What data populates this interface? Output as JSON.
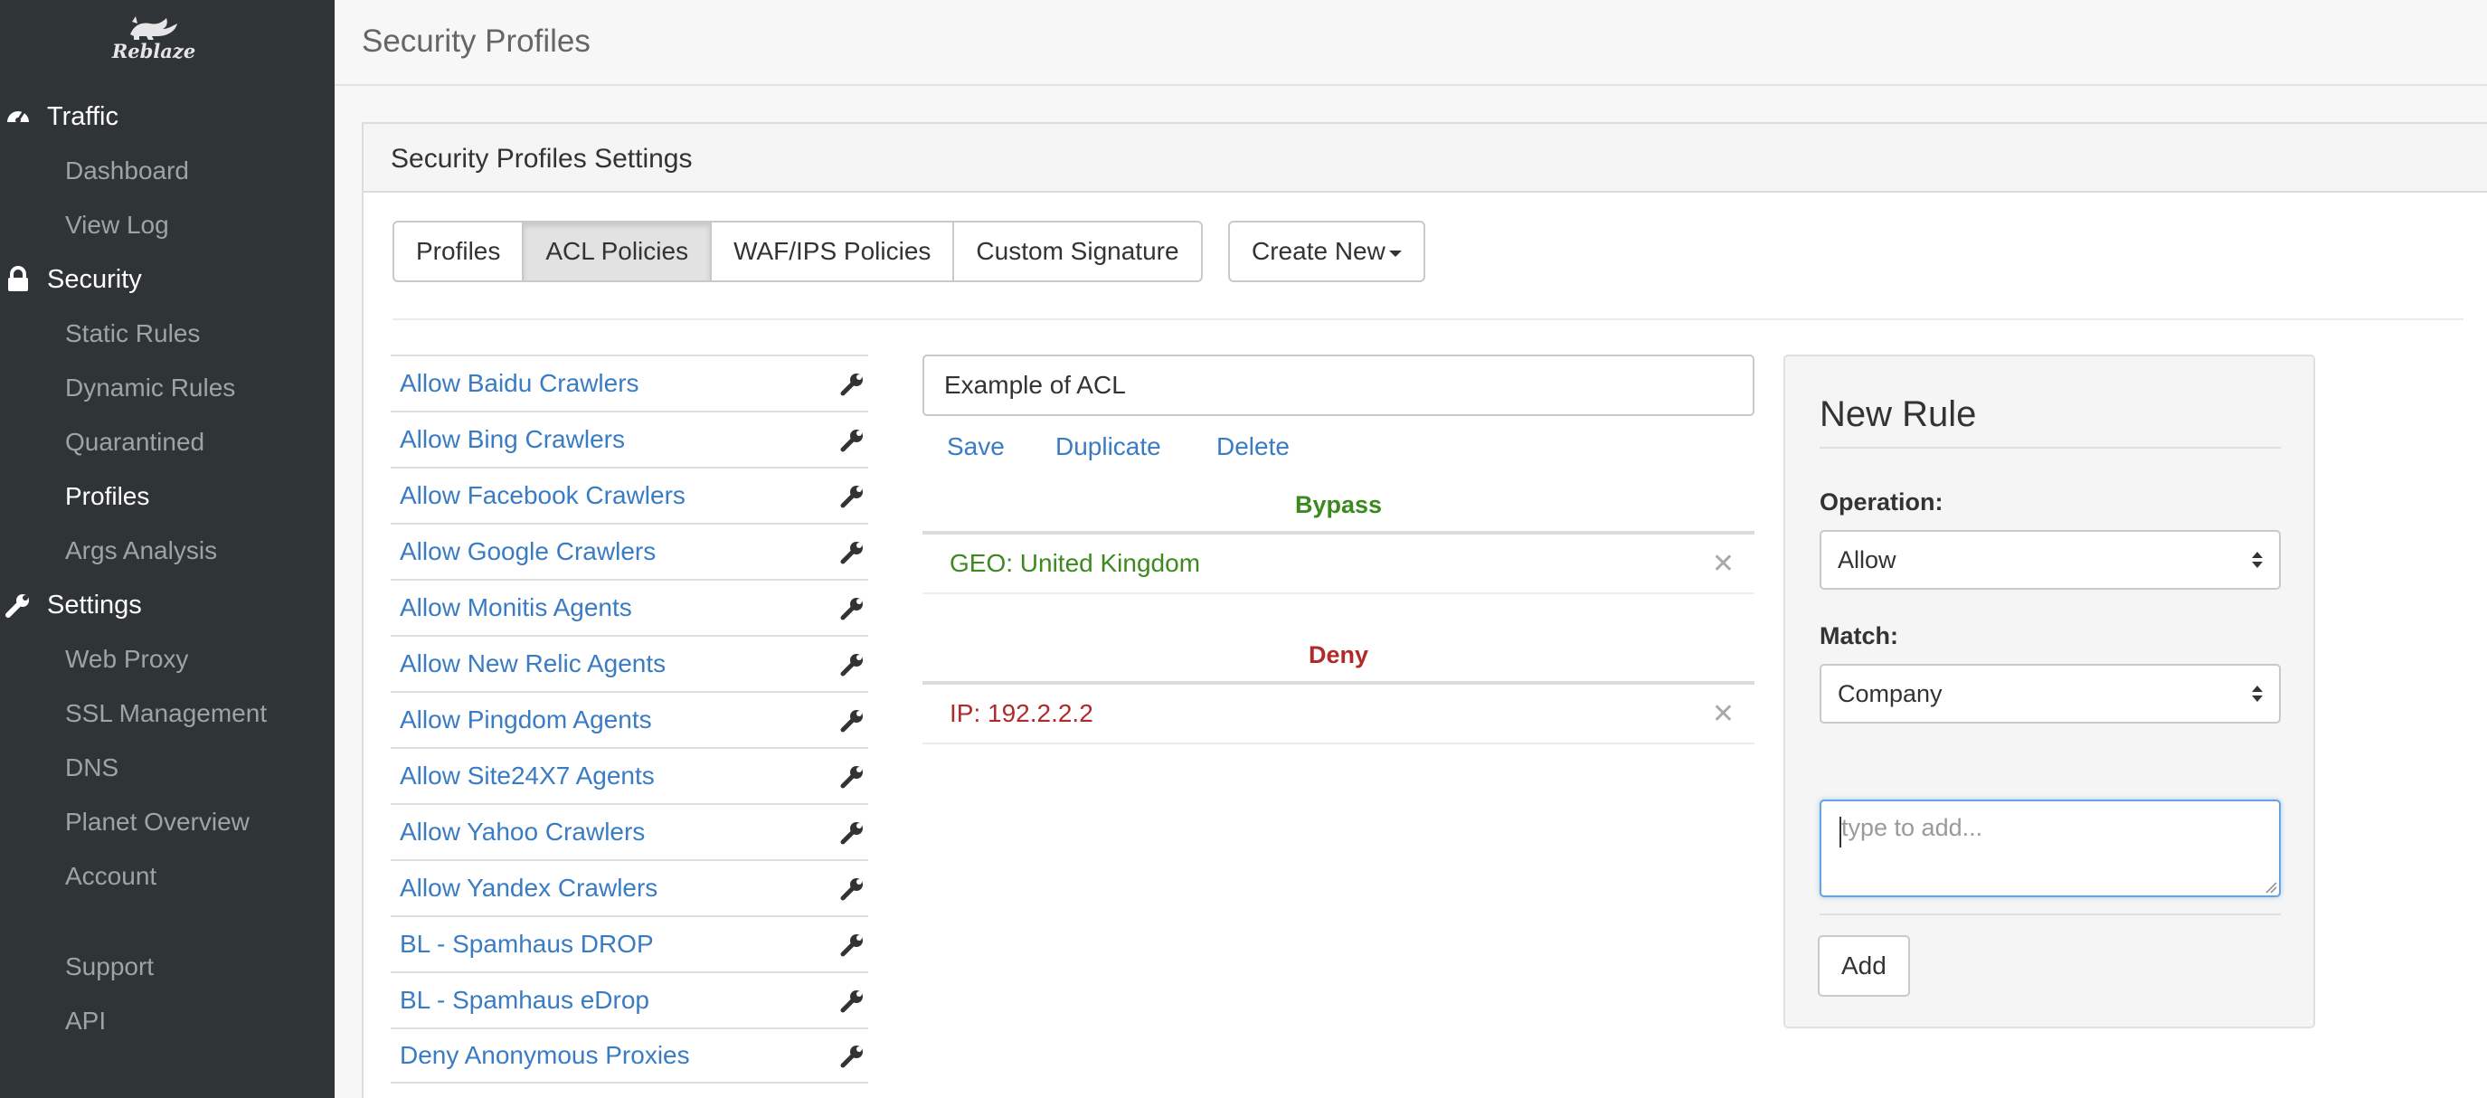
{
  "app": {
    "brand": "Reblaze"
  },
  "sidebar": {
    "sections": [
      {
        "label": "Traffic",
        "icon": "dashboard-gauge-icon"
      },
      {
        "label": "Security",
        "icon": "lock-icon"
      },
      {
        "label": "Settings",
        "icon": "wrench-icon"
      }
    ],
    "items": [
      {
        "label": "Dashboard"
      },
      {
        "label": "View Log"
      },
      {
        "label": "Static Rules"
      },
      {
        "label": "Dynamic Rules"
      },
      {
        "label": "Quarantined"
      },
      {
        "label": "Profiles",
        "active": true
      },
      {
        "label": "Args Analysis"
      },
      {
        "label": "Web Proxy"
      },
      {
        "label": "SSL Management"
      },
      {
        "label": "DNS"
      },
      {
        "label": "Planet Overview"
      },
      {
        "label": "Account"
      },
      {
        "label": "Support"
      },
      {
        "label": "API"
      }
    ]
  },
  "header": {
    "title": "Security Profiles"
  },
  "panel": {
    "title": "Security Profiles Settings",
    "tabs": [
      {
        "label": "Profiles"
      },
      {
        "label": "ACL Policies",
        "active": true
      },
      {
        "label": "WAF/IPS Policies"
      },
      {
        "label": "Custom Signature"
      }
    ],
    "create_new": "Create New"
  },
  "policies": [
    "Allow Baidu Crawlers",
    "Allow Bing Crawlers",
    "Allow Facebook Crawlers",
    "Allow Google Crawlers",
    "Allow Monitis Agents",
    "Allow New Relic Agents",
    "Allow Pingdom Agents",
    "Allow Site24X7 Agents",
    "Allow Yahoo Crawlers",
    "Allow Yandex Crawlers",
    "BL - Spamhaus DROP",
    "BL - Spamhaus eDrop",
    "Deny Anonymous Proxies"
  ],
  "editor": {
    "name_value": "Example of ACL",
    "actions": {
      "save": "Save",
      "duplicate": "Duplicate",
      "delete": "Delete"
    },
    "bypass": {
      "title": "Bypass",
      "rules": [
        "GEO: United Kingdom"
      ]
    },
    "deny": {
      "title": "Deny",
      "rules": [
        "IP: 192.2.2.2"
      ]
    }
  },
  "new_rule": {
    "title": "New Rule",
    "operation_label": "Operation:",
    "operation_value": "Allow",
    "match_label": "Match:",
    "match_value": "Company",
    "input_placeholder": "type to add...",
    "add_label": "Add"
  },
  "colors": {
    "sidebar_bg": "#2f3437",
    "link": "#3a7cc4",
    "bypass": "#3c8a1f",
    "deny": "#b02a2a"
  }
}
